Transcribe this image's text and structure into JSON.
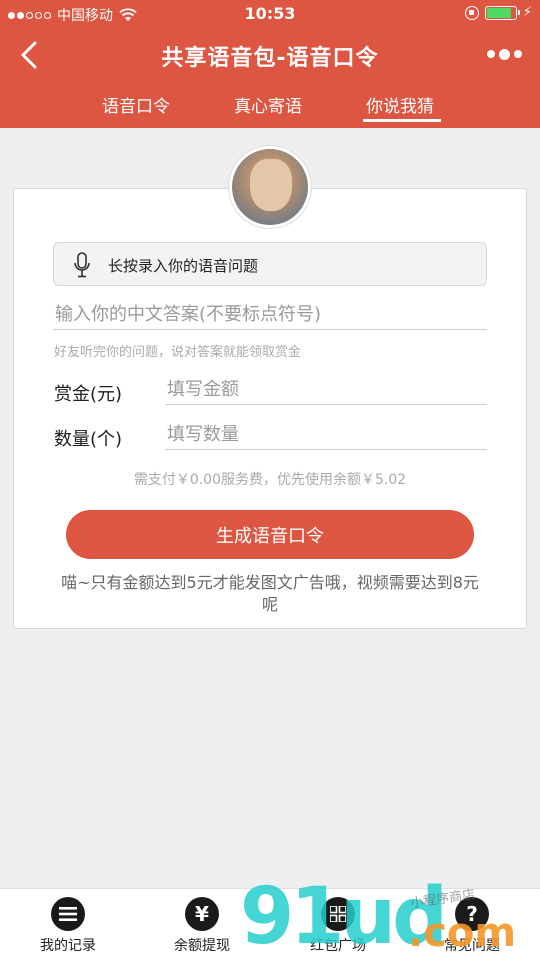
{
  "status_bar": {
    "carrier": "中国移动",
    "time": "10:53"
  },
  "header": {
    "title": "共享语音包-语音口令",
    "tabs": [
      {
        "label": "语音口令"
      },
      {
        "label": "真心寄语"
      },
      {
        "label": "你说我猜",
        "active": true
      }
    ]
  },
  "form": {
    "voice_button_label": "长按录入你的语音问题",
    "answer_placeholder": "输入你的中文答案(不要标点符号)",
    "answer_hint": "好友听完你的问题，说对答案就能领取赏金",
    "reward_label": "赏金(元)",
    "reward_placeholder": "填写金额",
    "quantity_label": "数量(个)",
    "quantity_placeholder": "填写数量",
    "fee_note": "需支付￥0.00服务费，优先使用余额￥5.02",
    "submit_label": "生成语音口令",
    "notice": "喵~只有金额达到5元才能发图文广告哦，视频需要达到8元呢"
  },
  "bottom_nav": {
    "items": [
      {
        "label": "我的记录",
        "icon": "list-icon"
      },
      {
        "label": "余额提现",
        "icon": "yen-icon"
      },
      {
        "label": "红包广场",
        "icon": "grid-icon"
      },
      {
        "label": "常见问题",
        "icon": "question-icon"
      }
    ]
  },
  "watermark": {
    "brand": "91ud",
    "suffix": ".com",
    "tagline": "小程序商店"
  },
  "colors": {
    "brand": "#dd5642",
    "battery": "#4cd964"
  }
}
